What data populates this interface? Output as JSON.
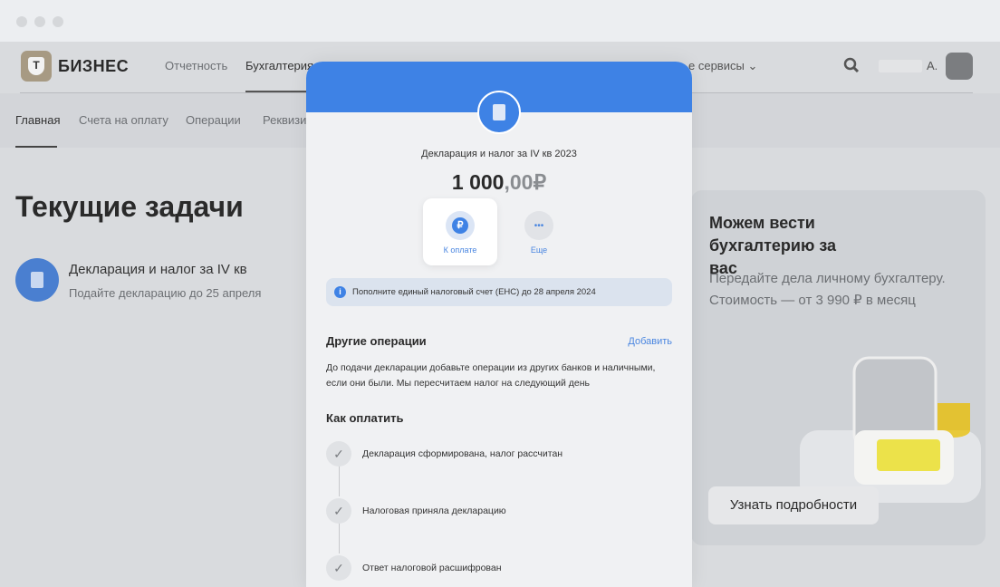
{
  "header": {
    "brand": "БИЗНЕС",
    "logo_letter": "Т",
    "nav": [
      "Отчетность",
      "Бухгалтерия"
    ],
    "services": "е сервисы",
    "user": "А."
  },
  "subnav": [
    "Главная",
    "Счета на оплату",
    "Операции",
    "Реквизи"
  ],
  "main": {
    "title": "Текущие задачи",
    "task": {
      "title": "Декларация и налог за IV кв",
      "subtitle": "Подайте декларацию до 25 апреля"
    }
  },
  "promo": {
    "title": "Можем вести бухгалтерию за вас",
    "text": "Передайте дела личному бухгалтеру. Стоимость — от 3 990 ₽ в месяц",
    "button": "Узнать подробности"
  },
  "modal": {
    "title": "Декларация и налог за IV кв 2023",
    "amount_int": "1 000",
    "amount_dec": ",00₽",
    "actions": [
      {
        "label": "К оплате",
        "icon": "₽"
      },
      {
        "label": "Еще",
        "icon": "•••"
      }
    ],
    "info": "Пополните единый налоговый счет (ЕНС) до 28 апреля 2024",
    "other_title": "Другие операции",
    "add": "Добавить",
    "other_text": "До подачи декларации добавьте операции из других банков и наличными, если они были. Мы пересчитаем налог на следующий день",
    "pay_title": "Как оплатить",
    "steps": [
      "Декларация сформирована, налог рассчитан",
      "Налоговая приняла декларацию",
      "Ответ налоговой расшифрован"
    ]
  },
  "colors": {
    "accent": "#3e82e5"
  }
}
